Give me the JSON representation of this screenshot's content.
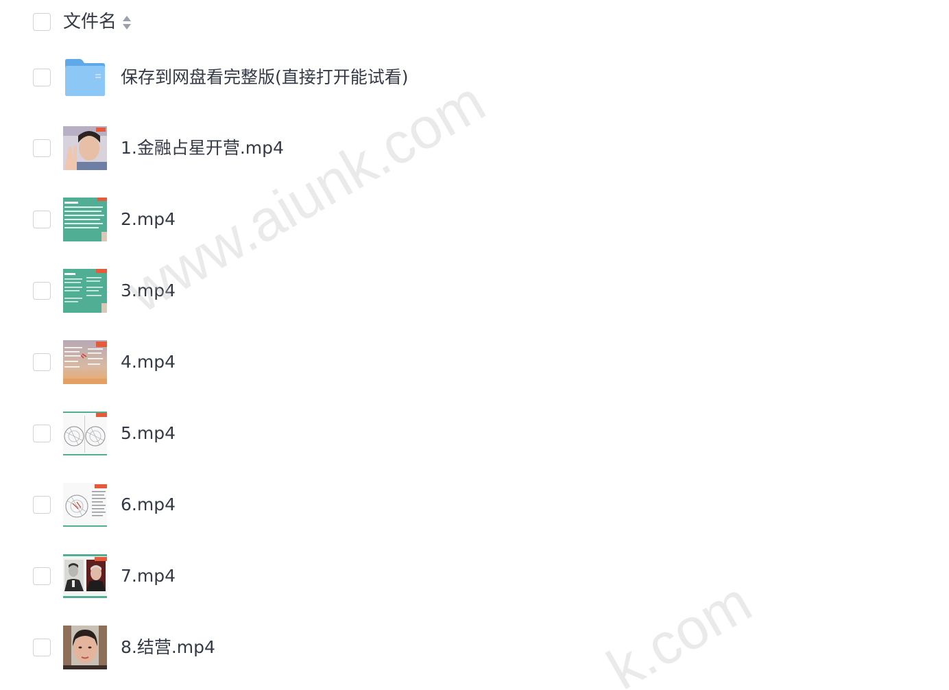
{
  "header": {
    "title": "文件名"
  },
  "files": [
    {
      "name": "保存到网盘看完整版(直接打开能试看)",
      "type": "folder",
      "thumb": "folder-icon"
    },
    {
      "name": "1.金融占星开营.mp4",
      "type": "video",
      "thumb": "video-thumbnail-presenter"
    },
    {
      "name": "2.mp4",
      "type": "video",
      "thumb": "video-thumbnail-slide-teal"
    },
    {
      "name": "3.mp4",
      "type": "video",
      "thumb": "video-thumbnail-slide-teal"
    },
    {
      "name": "4.mp4",
      "type": "video",
      "thumb": "video-thumbnail-slide-sunset"
    },
    {
      "name": "5.mp4",
      "type": "video",
      "thumb": "video-thumbnail-chart-wheel"
    },
    {
      "name": "6.mp4",
      "type": "video",
      "thumb": "video-thumbnail-chart-wheel"
    },
    {
      "name": "7.mp4",
      "type": "video",
      "thumb": "video-thumbnail-portraits"
    },
    {
      "name": "8.结营.mp4",
      "type": "video",
      "thumb": "video-thumbnail-presenter"
    }
  ],
  "watermark": {
    "text_1": "www.aiunk.com",
    "text_2": "k.com"
  },
  "colors": {
    "text": "#333a45",
    "checkbox_border": "#cfd3d9",
    "folder_blue": "#7fbef0",
    "teal": "#4fae94"
  }
}
